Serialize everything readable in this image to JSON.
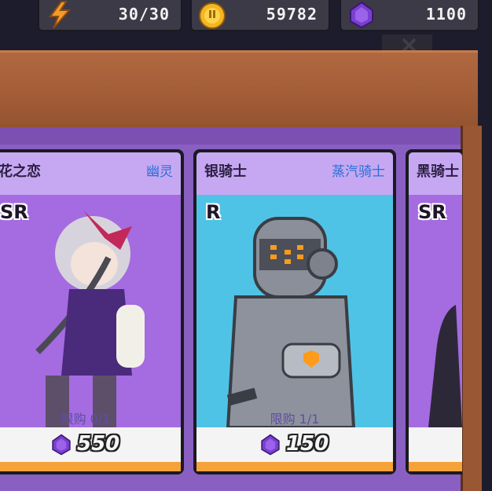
{
  "resources": {
    "energy": {
      "icon": "lightning-icon",
      "value": "30/30"
    },
    "coins": {
      "icon": "coin-icon",
      "value": "59782"
    },
    "gems": {
      "icon": "purple-gem-icon",
      "value": "1100"
    }
  },
  "close_button": {
    "icon": "close-icon",
    "label": "×"
  },
  "cards": [
    {
      "name": "花之恋",
      "type": "幽灵",
      "rarity": "SR",
      "limit": "限购  0/1",
      "price": "550",
      "price_icon": "purple-gem-icon",
      "art_bg": "#a56be0"
    },
    {
      "name": "银骑士",
      "type": "蒸汽骑士",
      "rarity": "R",
      "limit": "限购  1/1",
      "price": "150",
      "price_icon": "purple-gem-icon",
      "art_bg": "#4fc3e6"
    },
    {
      "name": "黑骑士",
      "type": "",
      "rarity": "SR",
      "limit": "",
      "price": "",
      "price_icon": "",
      "art_bg": "#a56be0"
    }
  ],
  "colors": {
    "accent_orange": "#f5a23a",
    "gem_purple": "#7a3fd0",
    "wood": "#a15c37"
  }
}
